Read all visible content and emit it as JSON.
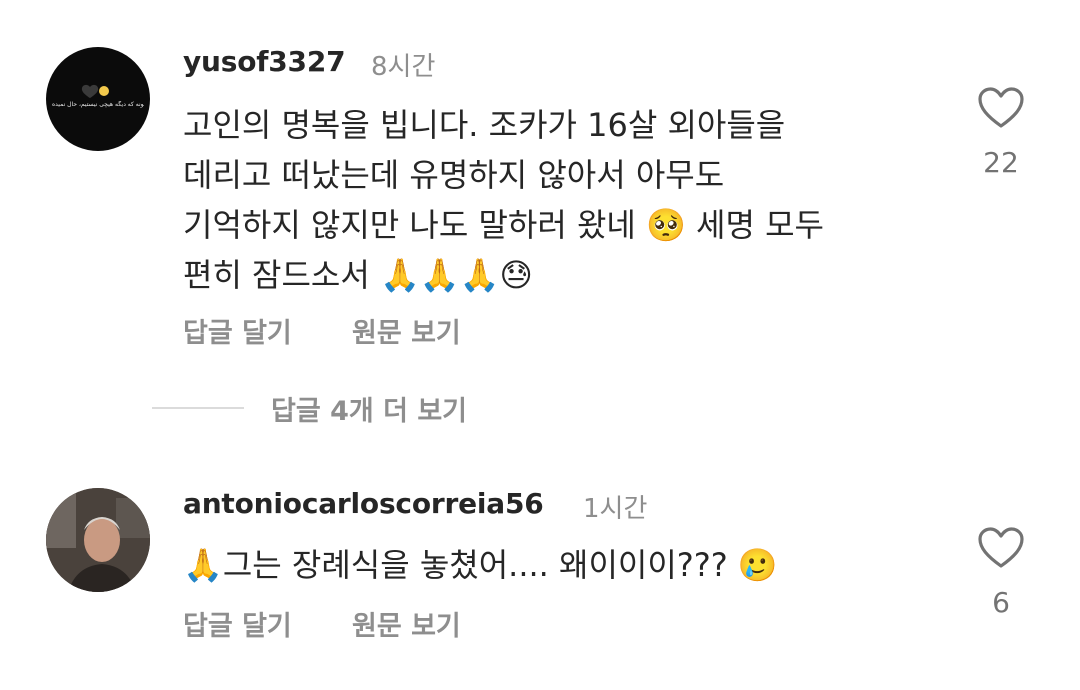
{
  "comments": [
    {
      "username": "yusof3327",
      "time": "8시간",
      "avatar_text": "مگه چند سالمونه که دیگه هیچی نیستیم، حال نمیده",
      "text": "고인의 명복을 빕니다. 조카가 16살 외아들을\n데리고 떠났는데 유명하지 않아서 아무도\n기억하지 않지만 나도 말하러 왔네 🥺 세명 모두\n편히 잠드소서 🙏🙏🙏😓",
      "reply_label": "답글 달기",
      "translate_label": "원문 보기",
      "likes": "22"
    },
    {
      "username": "antoniocarloscorreia56",
      "time": "1시간",
      "text": "🙏그는 장례식을 놓쳤어.... 왜이이이??? 🥲",
      "reply_label": "답글 달기",
      "translate_label": "원문 보기",
      "likes": "6"
    }
  ],
  "more_replies_label": "답글 4개 더 보기",
  "icons": {
    "like": "heart-outline-icon"
  }
}
